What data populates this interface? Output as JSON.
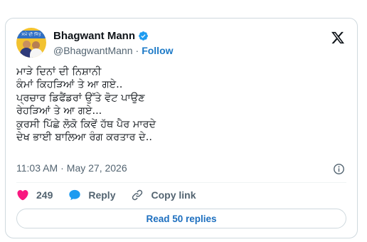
{
  "author": {
    "display_name": "Bhagwant Mann",
    "handle": "@BhagwantMann",
    "separator": "·",
    "follow_label": "Follow",
    "avatar_banner_text": "ਸਮੇਂ ਦੀ ਜਿੱਤ"
  },
  "tweet": {
    "lines": [
      "ਮਾੜੇ ਦਿਨਾਂ ਦੀ ਨਿਸ਼ਾਨੀ",
      "ਕੰਮਾਂ ਕਿਹੜਿਆਂ ਤੇ ਆ ਗਏ..",
      "ਪ੍ਰਚਾਰ ਡਿਫੈਂਡਰਾਂ ਉੱਤੇ ਵੋਟ ਪਾਉਣ",
      "ਰੇਹੜਿਆਂ ਤੇ ਆ ਗਏ...",
      "ਕੁਰਸੀ ਪਿੱਛੇ ਲੋਕੋ ਕਿਵੇਂ ਹੱਥ ਪੈਰ ਮਾਰਦੇ",
      "ਦੇਖ ਭਾਈ ਬਾਲਿਆ ਰੰਗ ਕਰਤਾਰ ਦੇ.."
    ],
    "time": "11:03 AM",
    "separator": "·",
    "date": "May 27, 2026"
  },
  "actions": {
    "like_count": "249",
    "reply_label": "Reply",
    "copy_link_label": "Copy link"
  },
  "replies_button_label": "Read 50 replies",
  "icons": {
    "verified": "verified-badge-icon",
    "x_logo": "x-logo-icon",
    "info": "info-icon",
    "like": "heart-icon",
    "reply": "speech-bubble-icon",
    "copy_link": "link-icon"
  },
  "colors": {
    "accent": "#1d9bf0",
    "like": "#f91880",
    "text": "#0f1419",
    "secondary": "#536471",
    "border": "#cfd9de"
  }
}
